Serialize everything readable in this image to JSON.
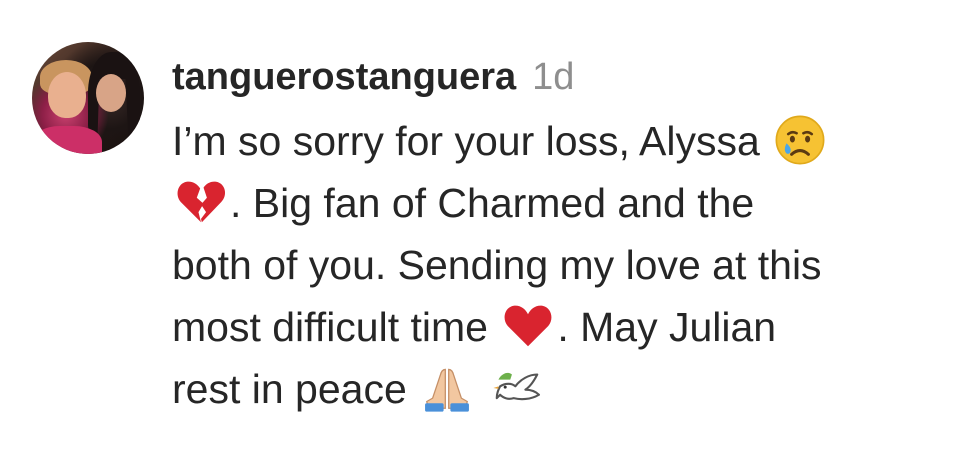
{
  "comment": {
    "username": "tanguerostanguera",
    "time": "1d",
    "lines": [
      {
        "text": "I’m so sorry for your loss, Alyssa"
      },
      {
        "text": ". Big fan of Charmed and the"
      },
      {
        "text": "both of you. Sending my love at this"
      },
      {
        "text": "most difficult time",
        "after": ". May Julian"
      },
      {
        "text": "rest in peace"
      }
    ]
  }
}
